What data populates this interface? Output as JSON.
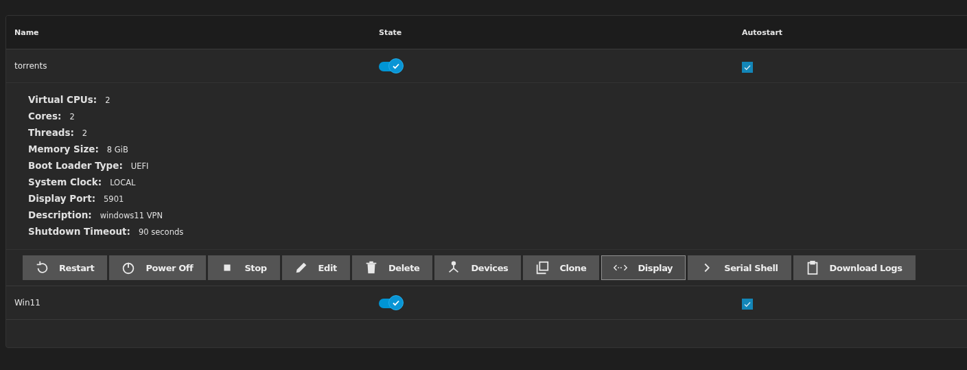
{
  "table": {
    "columns": [
      "Name",
      "State",
      "Autostart"
    ],
    "rows": [
      {
        "name": "torrents",
        "running": true,
        "autostart": true,
        "expanded": true,
        "details": [
          {
            "label": "Virtual CPUs:",
            "value": "2"
          },
          {
            "label": "Cores:",
            "value": "2"
          },
          {
            "label": "Threads:",
            "value": "2"
          },
          {
            "label": "Memory Size:",
            "value": "8 GiB"
          },
          {
            "label": "Boot Loader Type:",
            "value": "UEFI"
          },
          {
            "label": "System Clock:",
            "value": "LOCAL"
          },
          {
            "label": "Display Port:",
            "value": "5901"
          },
          {
            "label": "Description:",
            "value": "windows11 VPN"
          },
          {
            "label": "Shutdown Timeout:",
            "value": "90 seconds"
          }
        ],
        "actions": [
          {
            "label": "Restart",
            "focused": false
          },
          {
            "label": "Power Off",
            "focused": false
          },
          {
            "label": "Stop",
            "focused": false
          },
          {
            "label": "Edit",
            "focused": false
          },
          {
            "label": "Delete",
            "focused": false
          },
          {
            "label": "Devices",
            "focused": false
          },
          {
            "label": "Clone",
            "focused": false
          },
          {
            "label": "Display",
            "focused": true
          },
          {
            "label": "Serial Shell",
            "focused": false
          },
          {
            "label": "Download Logs",
            "focused": false
          }
        ]
      },
      {
        "name": "Win11",
        "running": true,
        "autostart": true,
        "expanded": false
      }
    ]
  }
}
